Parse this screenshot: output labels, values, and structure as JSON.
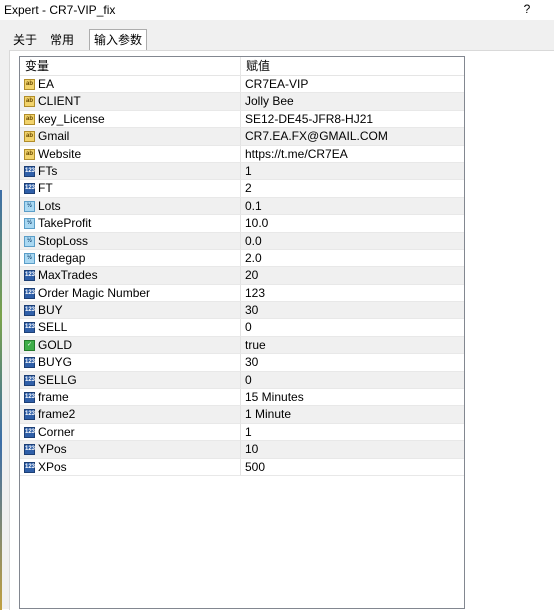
{
  "window": {
    "title": "Expert - CR7-VIP_fix",
    "help_label": "?"
  },
  "tabs": [
    {
      "label": "关于",
      "active": false
    },
    {
      "label": "常用",
      "active": false
    },
    {
      "label": "输入参数",
      "active": true
    }
  ],
  "table": {
    "columns": {
      "name": "变量",
      "value": "赋值"
    },
    "rows": [
      {
        "icon": "string-type-icon",
        "name": "EA",
        "value": "CR7EA-VIP"
      },
      {
        "icon": "string-type-icon",
        "name": "CLIENT",
        "value": "Jolly Bee"
      },
      {
        "icon": "string-type-icon",
        "name": "key_License",
        "value": "SE12-DE45-JFR8-HJ21"
      },
      {
        "icon": "string-type-icon",
        "name": "Gmail",
        "value": "CR7.EA.FX@GMAIL.COM"
      },
      {
        "icon": "string-type-icon",
        "name": "Website",
        "value": "https://t.me/CR7EA"
      },
      {
        "icon": "integer-type-icon",
        "name": "FTs",
        "value": "1"
      },
      {
        "icon": "integer-type-icon",
        "name": "FT",
        "value": "2"
      },
      {
        "icon": "double-type-icon",
        "name": "Lots",
        "value": "0.1"
      },
      {
        "icon": "double-type-icon",
        "name": "TakeProfit",
        "value": "10.0"
      },
      {
        "icon": "double-type-icon",
        "name": "StopLoss",
        "value": "0.0"
      },
      {
        "icon": "double-type-icon",
        "name": "tradegap",
        "value": "2.0"
      },
      {
        "icon": "integer-type-icon",
        "name": "MaxTrades",
        "value": "20"
      },
      {
        "icon": "integer-type-icon",
        "name": "Order Magic Number",
        "value": "123"
      },
      {
        "icon": "integer-type-icon",
        "name": "BUY",
        "value": "30"
      },
      {
        "icon": "integer-type-icon",
        "name": "SELL",
        "value": "0"
      },
      {
        "icon": "bool-type-icon",
        "name": "GOLD",
        "value": "true"
      },
      {
        "icon": "integer-type-icon",
        "name": "BUYG",
        "value": "30"
      },
      {
        "icon": "integer-type-icon",
        "name": "SELLG",
        "value": "0"
      },
      {
        "icon": "integer-type-icon",
        "name": "frame",
        "value": "15 Minutes"
      },
      {
        "icon": "integer-type-icon",
        "name": "frame2",
        "value": "1 Minute"
      },
      {
        "icon": "integer-type-icon",
        "name": "Corner",
        "value": "1"
      },
      {
        "icon": "integer-type-icon",
        "name": "YPos",
        "value": "10"
      },
      {
        "icon": "integer-type-icon",
        "name": "XPos",
        "value": "500"
      }
    ]
  }
}
